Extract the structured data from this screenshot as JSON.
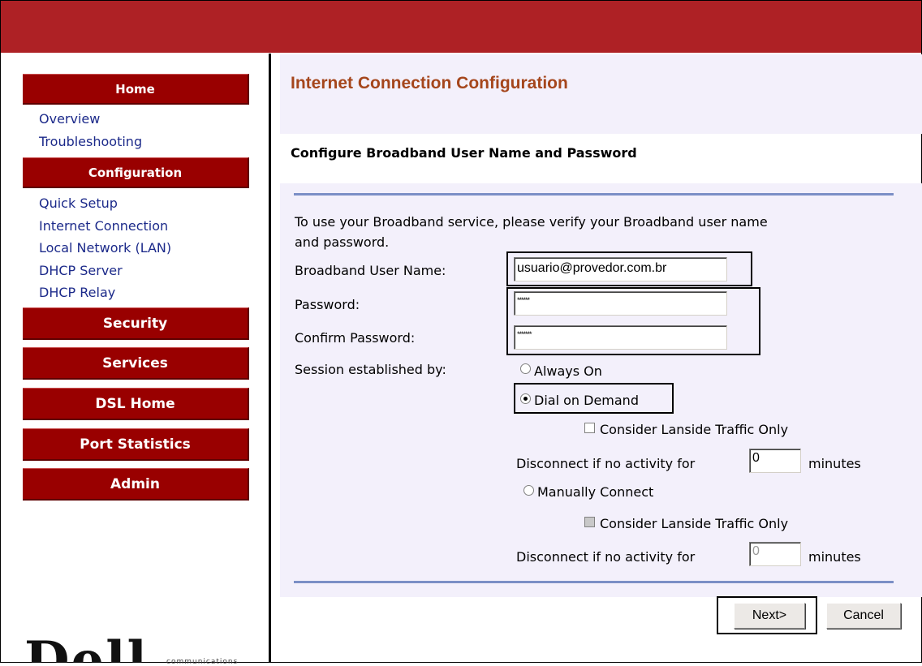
{
  "sidebar": {
    "home": "Home",
    "home_links": [
      "Overview",
      "Troubleshooting"
    ],
    "configuration": "Configuration",
    "config_links": [
      "Quick Setup",
      "Internet Connection",
      "Local Network (LAN)",
      "DHCP Server",
      "DHCP Relay"
    ],
    "security": "Security",
    "services": "Services",
    "dsl_home": "DSL Home",
    "port_statistics": "Port Statistics",
    "admin": "Admin"
  },
  "header": {
    "title": "Internet Connection Configuration",
    "subtitle": "Configure Broadband User Name and Password"
  },
  "form": {
    "intro_line1": "To use your Broadband service, please verify your Broadband user name",
    "intro_line2": "and password.",
    "username_label": "Broadband User Name:",
    "username_value": "usuario@provedor.com.br",
    "password_label": "Password:",
    "password_value": "******",
    "confirm_label": "Confirm Password:",
    "confirm_value": "*******",
    "session_label": "Session established by:",
    "always_on": "Always On",
    "dial_on_demand": "Dial on Demand",
    "consider_lanside_1": "Consider Lanside Traffic Only",
    "disconnect_label_1": "Disconnect if no activity for",
    "disconnect_value_1": "0",
    "minutes_1": "minutes",
    "manually_connect": "Manually Connect",
    "consider_lanside_2": "Consider Lanside Traffic Only",
    "disconnect_label_2": "Disconnect if no activity for",
    "disconnect_value_2": "0",
    "minutes_2": "minutes"
  },
  "buttons": {
    "next": "Next>",
    "cancel": "Cancel"
  },
  "logo": {
    "text": "Dell",
    "sub": "communications"
  },
  "colors": {
    "topbar": "#ae2125",
    "sidebar_header": "#990000",
    "title": "#a5461c",
    "link": "#1c2a8a",
    "panel": "#f3f0fb"
  }
}
